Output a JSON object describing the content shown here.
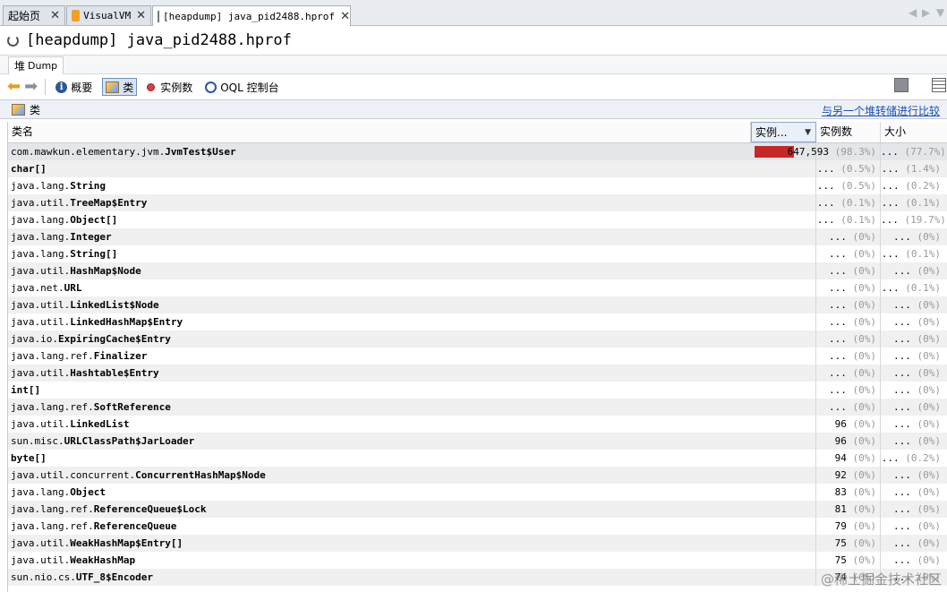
{
  "tabs": [
    {
      "label": "起始页",
      "active": false
    },
    {
      "label": "VisualVM",
      "active": false
    },
    {
      "label": "[heapdump] java_pid2488.hprof",
      "active": true
    }
  ],
  "title": "[heapdump] java_pid2488.hprof",
  "subtab": {
    "label_cjk": "堆",
    "label": "Dump"
  },
  "toolbar": {
    "summary_label": "概要",
    "classes_label": "类",
    "instances_label": "实例数",
    "oql_label": "OQL 控制台"
  },
  "panel": {
    "title": "类",
    "compare_link": "与另一个堆转储进行比较"
  },
  "table": {
    "headers": {
      "name": "类名",
      "instances_bar": "实例...",
      "instances": "实例数",
      "size": "大小"
    },
    "rows": [
      {
        "pkg": "com.mawkun.elementary.jvm.",
        "cls": "JvmTest$User",
        "count": "647,593",
        "count_pct": "(98.3%)",
        "size": "...",
        "size_pct": "(77.7%)",
        "share": 0.983
      },
      {
        "pkg": "",
        "cls": "char[]",
        "count": "...",
        "count_pct": "(0.5%)",
        "size": "...",
        "size_pct": "(1.4%)"
      },
      {
        "pkg": "java.lang.",
        "cls": "String",
        "count": "...",
        "count_pct": "(0.5%)",
        "size": "...",
        "size_pct": "(0.2%)"
      },
      {
        "pkg": "java.util.",
        "cls": "TreeMap$Entry",
        "count": "...",
        "count_pct": "(0.1%)",
        "size": "...",
        "size_pct": "(0.1%)"
      },
      {
        "pkg": "java.lang.",
        "cls": "Object[]",
        "count": "...",
        "count_pct": "(0.1%)",
        "size": "...",
        "size_pct": "(19.7%)"
      },
      {
        "pkg": "java.lang.",
        "cls": "Integer",
        "count": "...",
        "count_pct": "(0%)",
        "size": "...",
        "size_pct": "(0%)"
      },
      {
        "pkg": "java.lang.",
        "cls": "String[]",
        "count": "...",
        "count_pct": "(0%)",
        "size": "...",
        "size_pct": "(0.1%)"
      },
      {
        "pkg": "java.util.",
        "cls": "HashMap$Node",
        "count": "...",
        "count_pct": "(0%)",
        "size": "...",
        "size_pct": "(0%)"
      },
      {
        "pkg": "java.net.",
        "cls": "URL",
        "count": "...",
        "count_pct": "(0%)",
        "size": "...",
        "size_pct": "(0.1%)"
      },
      {
        "pkg": "java.util.",
        "cls": "LinkedList$Node",
        "count": "...",
        "count_pct": "(0%)",
        "size": "...",
        "size_pct": "(0%)"
      },
      {
        "pkg": "java.util.",
        "cls": "LinkedHashMap$Entry",
        "count": "...",
        "count_pct": "(0%)",
        "size": "...",
        "size_pct": "(0%)"
      },
      {
        "pkg": "java.io.",
        "cls": "ExpiringCache$Entry",
        "count": "...",
        "count_pct": "(0%)",
        "size": "...",
        "size_pct": "(0%)"
      },
      {
        "pkg": "java.lang.ref.",
        "cls": "Finalizer",
        "count": "...",
        "count_pct": "(0%)",
        "size": "...",
        "size_pct": "(0%)"
      },
      {
        "pkg": "java.util.",
        "cls": "Hashtable$Entry",
        "count": "...",
        "count_pct": "(0%)",
        "size": "...",
        "size_pct": "(0%)"
      },
      {
        "pkg": "",
        "cls": "int[]",
        "count": "...",
        "count_pct": "(0%)",
        "size": "...",
        "size_pct": "(0%)"
      },
      {
        "pkg": "java.lang.ref.",
        "cls": "SoftReference",
        "count": "...",
        "count_pct": "(0%)",
        "size": "...",
        "size_pct": "(0%)"
      },
      {
        "pkg": "java.util.",
        "cls": "LinkedList",
        "count": "96",
        "count_pct": "(0%)",
        "size": "...",
        "size_pct": "(0%)"
      },
      {
        "pkg": "sun.misc.",
        "cls": "URLClassPath$JarLoader",
        "count": "96",
        "count_pct": "(0%)",
        "size": "...",
        "size_pct": "(0%)"
      },
      {
        "pkg": "",
        "cls": "byte[]",
        "count": "94",
        "count_pct": "(0%)",
        "size": "...",
        "size_pct": "(0.2%)"
      },
      {
        "pkg": "java.util.concurrent.",
        "cls": "ConcurrentHashMap$Node",
        "count": "92",
        "count_pct": "(0%)",
        "size": "...",
        "size_pct": "(0%)"
      },
      {
        "pkg": "java.lang.",
        "cls": "Object",
        "count": "83",
        "count_pct": "(0%)",
        "size": "...",
        "size_pct": "(0%)"
      },
      {
        "pkg": "java.lang.ref.",
        "cls": "ReferenceQueue$Lock",
        "count": "81",
        "count_pct": "(0%)",
        "size": "...",
        "size_pct": "(0%)"
      },
      {
        "pkg": "java.lang.ref.",
        "cls": "ReferenceQueue",
        "count": "79",
        "count_pct": "(0%)",
        "size": "...",
        "size_pct": "(0%)"
      },
      {
        "pkg": "java.util.",
        "cls": "WeakHashMap$Entry[]",
        "count": "75",
        "count_pct": "(0%)",
        "size": "...",
        "size_pct": "(0%)"
      },
      {
        "pkg": "java.util.",
        "cls": "WeakHashMap",
        "count": "75",
        "count_pct": "(0%)",
        "size": "...",
        "size_pct": "(0%)"
      },
      {
        "pkg": "sun.nio.cs.",
        "cls": "UTF_8$Encoder",
        "count": "74",
        "count_pct": "(0%)",
        "size": "...",
        "size_pct": "(0%)"
      }
    ]
  },
  "watermark": "@稀土掘金技术社区",
  "colors": {
    "bar": "#c62828",
    "link": "#1a4fb8",
    "back_arrow": "#e0a020"
  }
}
